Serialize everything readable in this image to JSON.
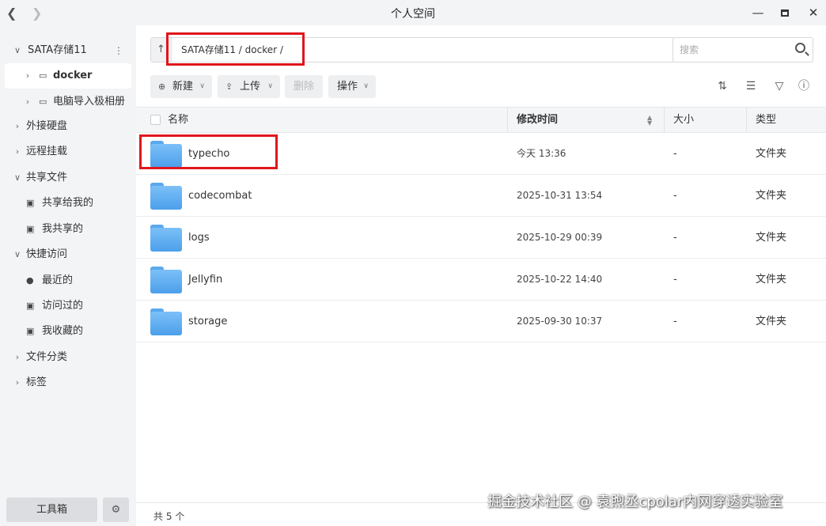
{
  "window": {
    "title": "个人空间"
  },
  "sidebar": {
    "storage": {
      "label": "SATA存储11"
    },
    "folders": [
      {
        "label": "docker"
      },
      {
        "label": "电脑导入极相册"
      }
    ],
    "sections": [
      {
        "label": "外接硬盘"
      },
      {
        "label": "远程挂载"
      },
      {
        "label": "共享文件"
      },
      {
        "label": "快捷访问"
      },
      {
        "label": "文件分类"
      },
      {
        "label": "标签"
      }
    ],
    "share_items": [
      {
        "label": "共享给我的"
      },
      {
        "label": "我共享的"
      }
    ],
    "quick_items": [
      {
        "label": "最近的"
      },
      {
        "label": "访问过的"
      },
      {
        "label": "我收藏的"
      }
    ],
    "toolbox_label": "工具箱"
  },
  "pathbar": {
    "path": "SATA存储11 / docker /"
  },
  "search": {
    "placeholder": "搜索"
  },
  "toolbar": {
    "new_label": "新建",
    "upload_label": "上传",
    "delete_label": "删除",
    "action_label": "操作"
  },
  "table": {
    "headers": {
      "name": "名称",
      "modified": "修改时间",
      "size": "大小",
      "type": "类型"
    },
    "rows": [
      {
        "name": "typecho",
        "modified": "今天 13:36",
        "size": "-",
        "type": "文件夹"
      },
      {
        "name": "codecombat",
        "modified": "2025-10-31 13:54",
        "size": "-",
        "type": "文件夹"
      },
      {
        "name": "logs",
        "modified": "2025-10-29 00:39",
        "size": "-",
        "type": "文件夹"
      },
      {
        "name": "Jellyfin",
        "modified": "2025-10-22 14:40",
        "size": "-",
        "type": "文件夹"
      },
      {
        "name": "storage",
        "modified": "2025-09-30 10:37",
        "size": "-",
        "type": "文件夹"
      }
    ]
  },
  "footer": {
    "count_text": "共 5 个"
  },
  "watermark": "掘金技术社区 @ 袁煦丞cpolar内网穿透实验室",
  "colors": {
    "highlight": "#e0151d",
    "folder": "#5aa8ee"
  }
}
